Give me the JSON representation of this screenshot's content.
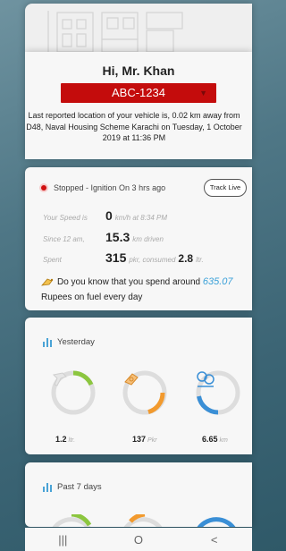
{
  "greeting": "Hi, Mr. Khan",
  "vehicle_plate": "ABC-1234",
  "location_lines": [
    "Last reported location of your vehicle is, 0.02 km away from",
    "D48, Naval Housing Scheme Karachi on Tuesday, 1 October",
    "2019 at 11:36 PM"
  ],
  "status": {
    "text": "Stopped - Ignition On 3 hrs  ago",
    "track_live_label": "Track Live",
    "speed_label": "Your Speed is",
    "speed_value": "0",
    "speed_suffix": "km/h at 8:34 PM",
    "since_label": "Since 12 am,",
    "distance_value": "15.3",
    "distance_suffix": "km  driven",
    "spent_label": "Spent",
    "spent_value": "315",
    "spent_suffix": "pkr, consumed",
    "consumed_value": "2.8",
    "consumed_unit": "ltr."
  },
  "fuel_tip": {
    "prefix": "Do you know that you spend around",
    "amount": "635.07",
    "suffix": "Rupees on fuel every day"
  },
  "yesterday": {
    "title": "Yesterday",
    "fuel_value": "1.2",
    "fuel_unit": "ltr.",
    "cost_value": "137",
    "cost_unit": "Pkr",
    "distance_value": "6.65",
    "distance_unit": "km"
  },
  "past7": {
    "title": "Past 7 days"
  },
  "colors": {
    "accent_red": "#c40c0c",
    "ring_green": "#8cc63f",
    "ring_orange": "#f29a2e",
    "ring_blue": "#3a8fd6"
  },
  "nav": {
    "recents": "|||",
    "home": "O",
    "back": "<"
  }
}
